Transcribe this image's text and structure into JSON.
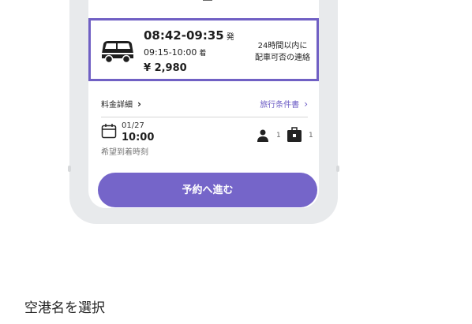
{
  "plan": {
    "departure_time": "08:42-09:35",
    "departure_suffix": "発",
    "arrival_time": "09:15-10:00",
    "arrival_suffix": "着",
    "price": "¥ 2,980",
    "notice_line1": "24時間以内に",
    "notice_line2": "配車可否の連絡"
  },
  "links": {
    "fee_details": "料金詳細",
    "travel_conditions": "旅行条件書"
  },
  "booking": {
    "date": "01/27",
    "time": "10:00",
    "time_caption": "希望到着時刻",
    "passengers": "1",
    "luggage": "1"
  },
  "actions": {
    "proceed": "予約へ進む"
  },
  "section": {
    "title": "空港名を選択"
  },
  "colors": {
    "accent": "#7565c9",
    "card_border": "#7060c4"
  },
  "icons": {
    "car": "car-icon",
    "calendar": "calendar-icon",
    "person": "person-icon",
    "luggage": "luggage-icon",
    "chevron": "chevron-right-icon"
  }
}
